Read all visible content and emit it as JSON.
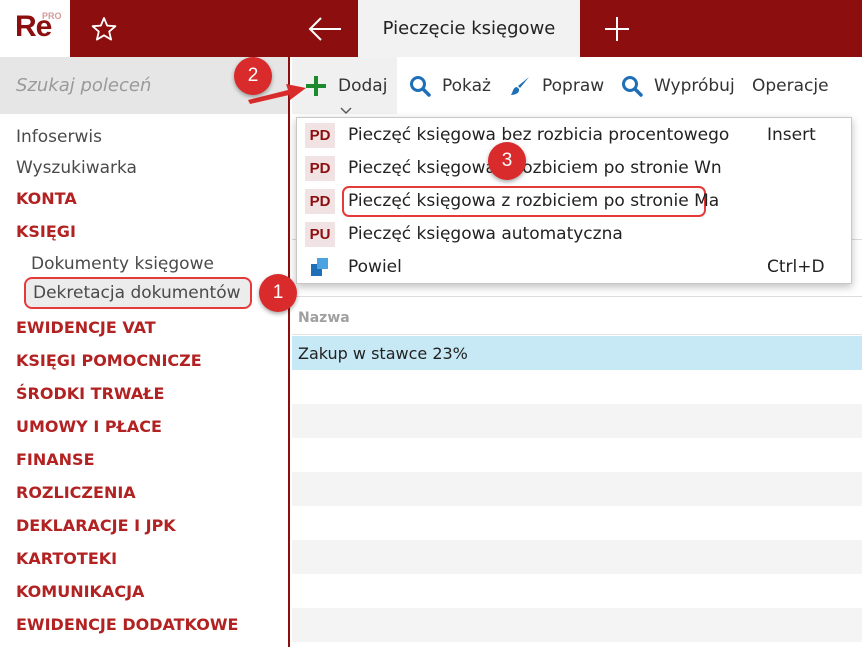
{
  "app": {
    "logo_text": "Re",
    "logo_badge": "PRO",
    "active_tab_title": "Pieczęcie księgowe"
  },
  "sidebar": {
    "search_placeholder": "Szukaj poleceń",
    "items": [
      {
        "label": "Infoserwis",
        "type": "plain"
      },
      {
        "label": "Wyszukiwarka",
        "type": "plain"
      },
      {
        "label": "KONTA",
        "type": "section"
      },
      {
        "label": "KSIĘGI",
        "type": "section"
      },
      {
        "label": "Dokumenty księgowe",
        "type": "sub"
      },
      {
        "label": "Dekretacja dokumentów",
        "type": "sub-selected"
      },
      {
        "label": "EWIDENCJE VAT",
        "type": "section"
      },
      {
        "label": "KSIĘGI POMOCNICZE",
        "type": "section"
      },
      {
        "label": "ŚRODKI TRWAŁE",
        "type": "section"
      },
      {
        "label": "UMOWY I PŁACE",
        "type": "section"
      },
      {
        "label": "FINANSE",
        "type": "section"
      },
      {
        "label": "ROZLICZENIA",
        "type": "section"
      },
      {
        "label": "DEKLARACJE I JPK",
        "type": "section"
      },
      {
        "label": "KARTOTEKI",
        "type": "section"
      },
      {
        "label": "KOMUNIKACJA",
        "type": "section"
      },
      {
        "label": "EWIDENCJE DODATKOWE",
        "type": "section"
      }
    ]
  },
  "toolbar": {
    "add_label": "Dodaj",
    "show_label": "Pokaż",
    "edit_label": "Popraw",
    "try_label": "Wypróbuj",
    "operations_label": "Operacje"
  },
  "dropdown": {
    "items": [
      {
        "badge": "PD",
        "label": "Pieczęć księgowa bez rozbicia procentowego",
        "shortcut": "Insert"
      },
      {
        "badge": "PD",
        "label": "Pieczęć księgowa z rozbiciem po stronie Wn",
        "shortcut": ""
      },
      {
        "badge": "PD",
        "label": "Pieczęć księgowa z rozbiciem po stronie Ma",
        "shortcut": ""
      },
      {
        "badge": "PU",
        "label": "Pieczęć księgowa automatyczna",
        "shortcut": ""
      },
      {
        "badge": "",
        "label": "Powiel",
        "shortcut": "Ctrl+D"
      }
    ]
  },
  "table": {
    "column_header": "Nazwa",
    "rows": [
      "Zakup w stawce 23%"
    ]
  },
  "callouts": {
    "one": "1",
    "two": "2",
    "three": "3"
  },
  "colors": {
    "brand": "#8d0e0e",
    "section_text": "#b22222",
    "callout": "#d92b2b",
    "highlight_border": "#e53a3a",
    "selected_row": "#c6e9f5",
    "add_icon": "#1e8a2e",
    "search_icon": "#1e6fb8"
  },
  "icons": [
    "star-icon",
    "back-arrow-icon",
    "plus-icon",
    "add-icon",
    "search-icon",
    "brush-icon",
    "copy-icon",
    "chevron-down-icon"
  ]
}
